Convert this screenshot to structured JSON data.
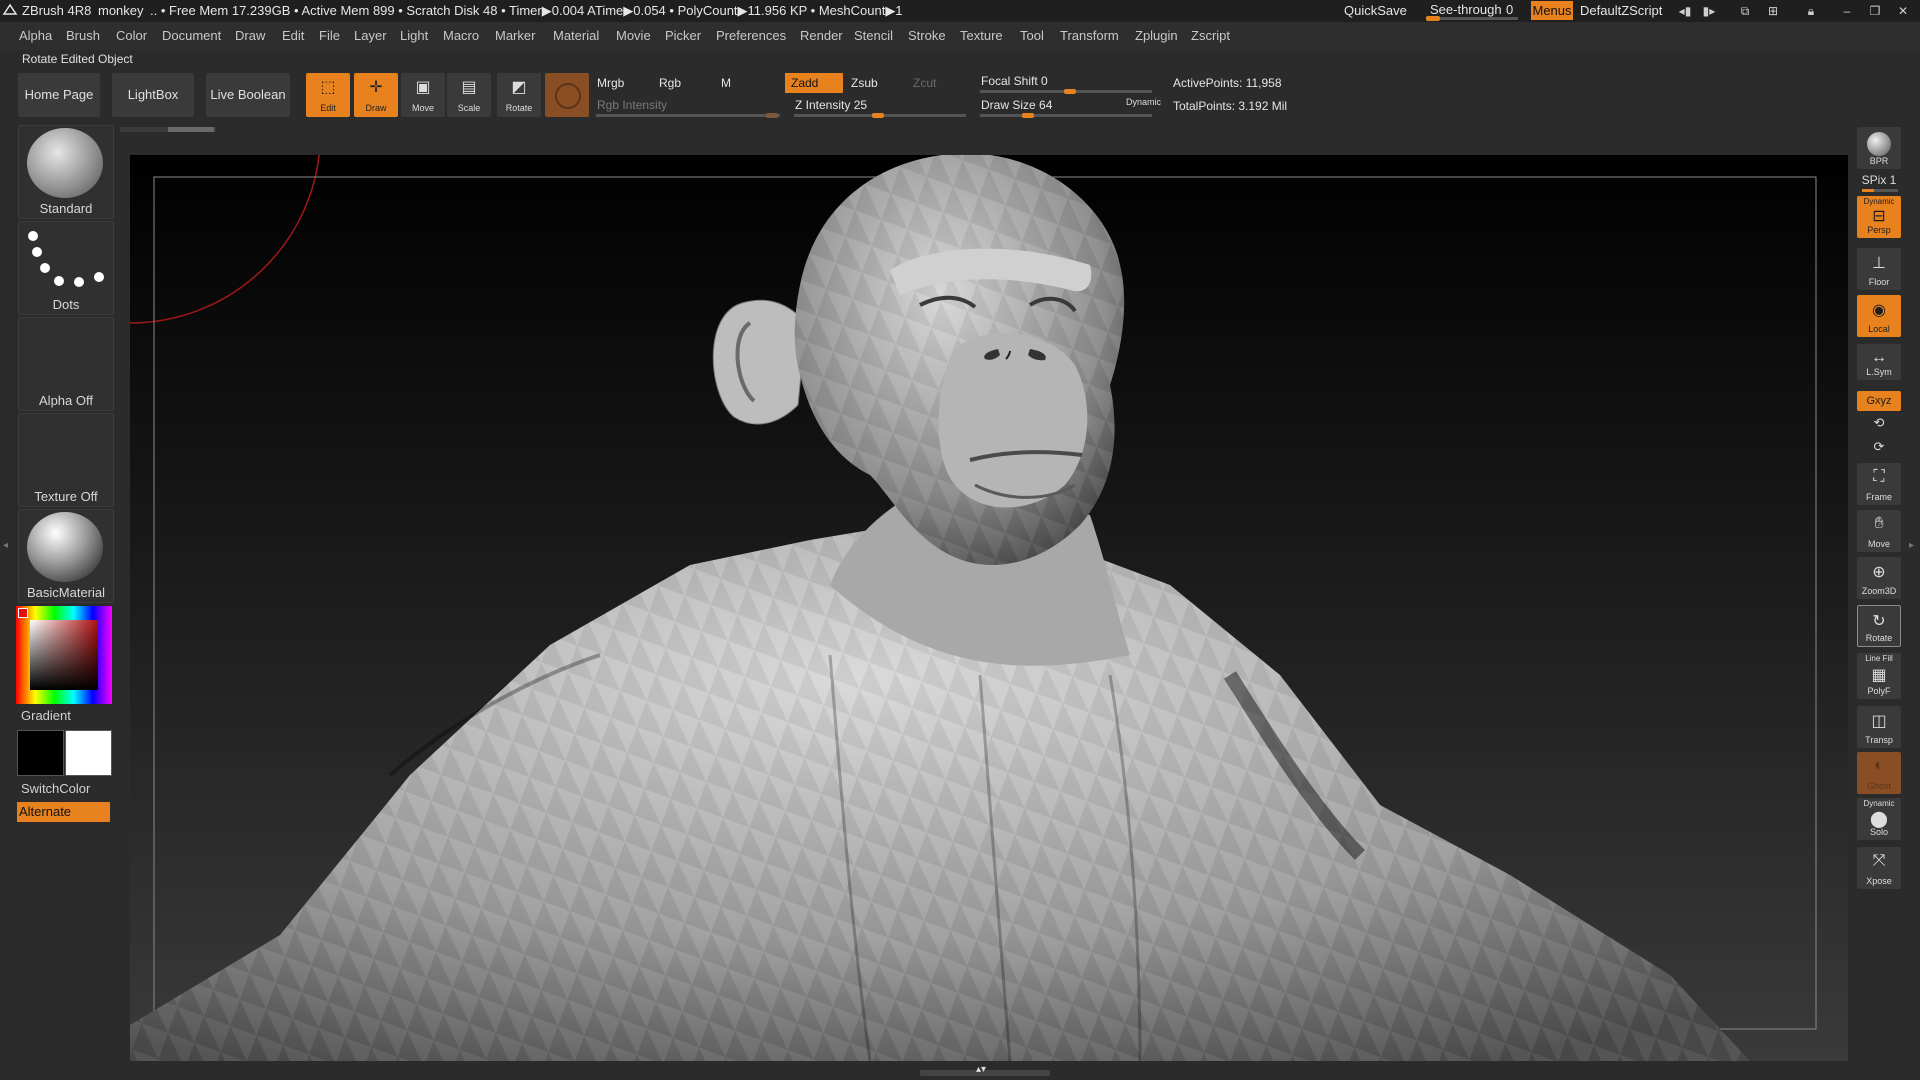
{
  "titlebar": {
    "app": "ZBrush 4R8",
    "document": "monkey",
    "stats": ".. • Free Mem 17.239GB • Active Mem 899 • Scratch Disk 48 • Timer▶0.004 ATime▶0.054 • PolyCount▶11.956 KP • MeshCount▶1",
    "quicksave": "QuickSave",
    "seethrough_label": "See-through",
    "seethrough_value": "0",
    "seethrough_level": 0,
    "menus": "Menus",
    "defaultzscript": "DefaultZScript"
  },
  "menubar": {
    "items": [
      "Alpha",
      "Brush",
      "Color",
      "Document",
      "Draw",
      "Edit",
      "File",
      "Layer",
      "Light",
      "Macro",
      "Marker",
      "Material",
      "Movie",
      "Picker",
      "Preferences",
      "Render",
      "Stencil",
      "Stroke",
      "Texture",
      "Tool",
      "Transform",
      "Zplugin",
      "Zscript"
    ]
  },
  "status": "Rotate Edited Object",
  "shelf": {
    "home": "Home Page",
    "lightbox": "LightBox",
    "liveboolean": "Live Boolean",
    "tools": [
      {
        "label": "Edit",
        "icon": "edit-icon",
        "active": true
      },
      {
        "label": "Draw",
        "icon": "draw-icon",
        "active": true
      },
      {
        "label": "Move",
        "icon": "move-icon",
        "active": false
      },
      {
        "label": "Scale",
        "icon": "scale-icon",
        "active": false
      },
      {
        "label": "Rotate",
        "icon": "rotate-icon",
        "active": false
      }
    ],
    "mrgb": "Mrgb",
    "rgb": "Rgb",
    "m": "M",
    "rgb_intensity": "Rgb Intensity",
    "zadd": "Zadd",
    "zsub": "Zsub",
    "zcut": "Zcut",
    "z_intensity_label": "Z Intensity",
    "z_intensity": "25",
    "focal_shift_label": "Focal Shift",
    "focal_shift": "0",
    "draw_size_label": "Draw Size",
    "draw_size": "64",
    "dynamic": "Dynamic",
    "active_points": "ActivePoints: 11,958",
    "total_points": "TotalPoints: 3.192 Mil"
  },
  "leftpanel": {
    "brush": "Standard",
    "stroke": "Dots",
    "alpha": "Alpha Off",
    "texture": "Texture Off",
    "material": "BasicMaterial",
    "gradient": "Gradient",
    "switchcolor": "SwitchColor",
    "alternate": "Alternate",
    "colors": {
      "primary": "#000000",
      "secondary": "#ffffff",
      "accent": "#e8821e"
    }
  },
  "rightbar": {
    "bpr": "BPR",
    "spix": "SPix 1",
    "persp_top": "Dynamic",
    "persp": "Persp",
    "floor": "Floor",
    "local": "Local",
    "lsym": "L.Sym",
    "xyz": "Gxyz",
    "frame": "Frame",
    "move": "Move",
    "zoom3d": "Zoom3D",
    "rotate": "Rotate",
    "linefill": "Line Fill",
    "polyf": "PolyF",
    "transp": "Transp",
    "ghost": "Ghost",
    "solo_top": "Dynamic",
    "solo": "Solo",
    "xpose": "Xpose"
  }
}
